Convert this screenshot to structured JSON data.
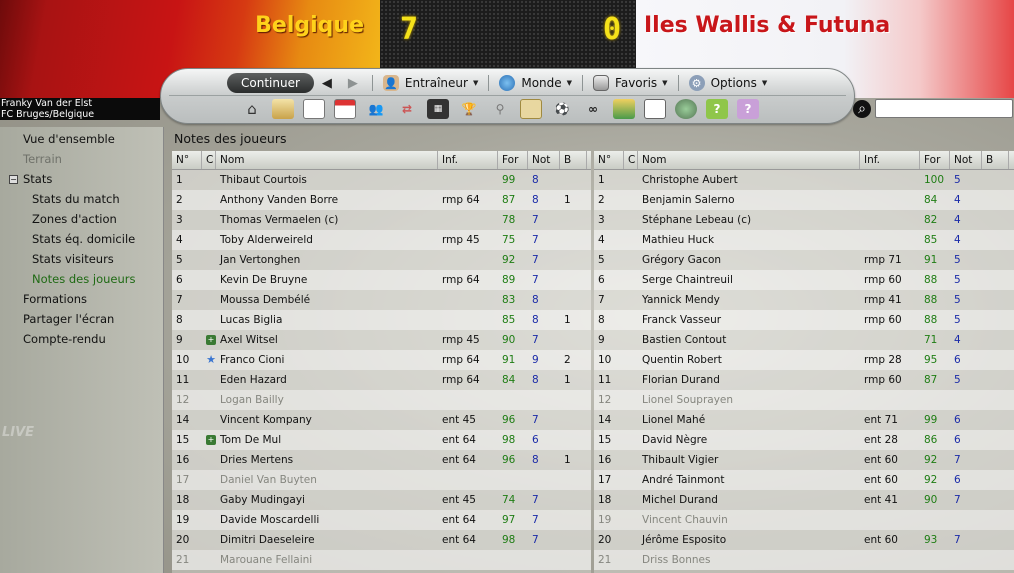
{
  "header": {
    "home_team": "Belgique",
    "home_score": "7",
    "away_score": "0",
    "away_team": "Iles Wallis & Futuna"
  },
  "toolbar": {
    "continue_label": "Continuer",
    "back_icon": "arrow-left",
    "forward_icon": "arrow-right",
    "menus": [
      {
        "label": "Entraîneur",
        "icon": "manager-icon"
      },
      {
        "label": "Monde",
        "icon": "globe-icon"
      },
      {
        "label": "Favoris",
        "icon": "bookmark-icon"
      },
      {
        "label": "Options",
        "icon": "options-icon"
      }
    ],
    "quick_icons": [
      "home-icon",
      "inbox-icon",
      "document-icon",
      "calendar-icon",
      "team-icon",
      "transfer-icon",
      "tactics-icon",
      "trophy-icon",
      "search-people-icon",
      "notes-icon",
      "match-icon",
      "binoculars-icon",
      "news-icon",
      "world-icon",
      "help-icon",
      "info-icon"
    ]
  },
  "manager": {
    "name": "Franky Van der Elst",
    "club": "FC Bruges/Belgique"
  },
  "search": {
    "placeholder": ""
  },
  "sidebar": {
    "items": [
      {
        "label": "Vue d'ensemble"
      },
      {
        "label": "Terrain"
      },
      {
        "label": "Stats"
      },
      {
        "label": "Stats du match"
      },
      {
        "label": "Zones d'action"
      },
      {
        "label": "Stats éq. domicile"
      },
      {
        "label": "Stats visiteurs"
      },
      {
        "label": "Notes des joueurs"
      },
      {
        "label": "Formations"
      },
      {
        "label": "Partager l'écran"
      },
      {
        "label": "Compte-rendu"
      }
    ],
    "stats_toggle": "−"
  },
  "main": {
    "title": "Notes des joueurs",
    "columns": [
      "N°",
      "C",
      "Nom",
      "Inf.",
      "For",
      "Not",
      "B"
    ],
    "home_players": [
      {
        "n": "1",
        "c": "",
        "name": "Thibaut Courtois",
        "inf": "",
        "for": "99",
        "not": "8",
        "b": ""
      },
      {
        "n": "2",
        "c": "",
        "name": "Anthony Vanden Borre",
        "inf": "rmp 64",
        "for": "87",
        "not": "8",
        "b": "1"
      },
      {
        "n": "3",
        "c": "",
        "name": "Thomas Vermaelen (c)",
        "inf": "",
        "for": "78",
        "not": "7",
        "b": ""
      },
      {
        "n": "4",
        "c": "",
        "name": "Toby Alderweireld",
        "inf": "rmp 45",
        "for": "75",
        "not": "7",
        "b": ""
      },
      {
        "n": "5",
        "c": "",
        "name": "Jan Vertonghen",
        "inf": "",
        "for": "92",
        "not": "7",
        "b": ""
      },
      {
        "n": "6",
        "c": "",
        "name": "Kevin De Bruyne",
        "inf": "rmp 64",
        "for": "89",
        "not": "7",
        "b": ""
      },
      {
        "n": "7",
        "c": "",
        "name": "Moussa Dembélé",
        "inf": "",
        "for": "83",
        "not": "8",
        "b": ""
      },
      {
        "n": "8",
        "c": "",
        "name": "Lucas Biglia",
        "inf": "",
        "for": "85",
        "not": "8",
        "b": "1"
      },
      {
        "n": "9",
        "c": "+",
        "name": "Axel Witsel",
        "inf": "rmp 45",
        "for": "90",
        "not": "7",
        "b": ""
      },
      {
        "n": "10",
        "c": "★",
        "name": "Franco Cioni",
        "inf": "rmp 64",
        "for": "91",
        "not": "9",
        "b": "2"
      },
      {
        "n": "11",
        "c": "",
        "name": "Eden Hazard",
        "inf": "rmp 64",
        "for": "84",
        "not": "8",
        "b": "1"
      },
      {
        "n": "12",
        "c": "",
        "name": "Logan Bailly",
        "inf": "",
        "for": "",
        "not": "",
        "b": ""
      },
      {
        "n": "14",
        "c": "",
        "name": "Vincent Kompany",
        "inf": "ent 45",
        "for": "96",
        "not": "7",
        "b": ""
      },
      {
        "n": "15",
        "c": "+",
        "name": "Tom De Mul",
        "inf": "ent 64",
        "for": "98",
        "not": "6",
        "b": ""
      },
      {
        "n": "16",
        "c": "",
        "name": "Dries Mertens",
        "inf": "ent 64",
        "for": "96",
        "not": "8",
        "b": "1"
      },
      {
        "n": "17",
        "c": "",
        "name": "Daniel Van Buyten",
        "inf": "",
        "for": "",
        "not": "",
        "b": ""
      },
      {
        "n": "18",
        "c": "",
        "name": "Gaby Mudingayi",
        "inf": "ent 45",
        "for": "74",
        "not": "7",
        "b": ""
      },
      {
        "n": "19",
        "c": "",
        "name": "Davide Moscardelli",
        "inf": "ent 64",
        "for": "97",
        "not": "7",
        "b": ""
      },
      {
        "n": "20",
        "c": "",
        "name": "Dimitri Daeseleire",
        "inf": "ent 64",
        "for": "98",
        "not": "7",
        "b": ""
      },
      {
        "n": "21",
        "c": "",
        "name": "Marouane Fellaini",
        "inf": "",
        "for": "",
        "not": "",
        "b": ""
      }
    ],
    "away_players": [
      {
        "n": "1",
        "c": "",
        "name": "Christophe Aubert",
        "inf": "",
        "for": "100",
        "not": "5",
        "b": ""
      },
      {
        "n": "2",
        "c": "",
        "name": "Benjamin Salerno",
        "inf": "",
        "for": "84",
        "not": "4",
        "b": ""
      },
      {
        "n": "3",
        "c": "",
        "name": "Stéphane Lebeau (c)",
        "inf": "",
        "for": "82",
        "not": "4",
        "b": ""
      },
      {
        "n": "4",
        "c": "",
        "name": "Mathieu Huck",
        "inf": "",
        "for": "85",
        "not": "4",
        "b": ""
      },
      {
        "n": "5",
        "c": "",
        "name": "Grégory Gacon",
        "inf": "rmp 71",
        "for": "91",
        "not": "5",
        "b": ""
      },
      {
        "n": "6",
        "c": "",
        "name": "Serge Chaintreuil",
        "inf": "rmp 60",
        "for": "88",
        "not": "5",
        "b": ""
      },
      {
        "n": "7",
        "c": "",
        "name": "Yannick Mendy",
        "inf": "rmp 41",
        "for": "88",
        "not": "5",
        "b": ""
      },
      {
        "n": "8",
        "c": "",
        "name": "Franck Vasseur",
        "inf": "rmp 60",
        "for": "88",
        "not": "5",
        "b": ""
      },
      {
        "n": "9",
        "c": "",
        "name": "Bastien Contout",
        "inf": "",
        "for": "71",
        "not": "4",
        "b": ""
      },
      {
        "n": "10",
        "c": "",
        "name": "Quentin Robert",
        "inf": "rmp 28",
        "for": "95",
        "not": "6",
        "b": ""
      },
      {
        "n": "11",
        "c": "",
        "name": "Florian Durand",
        "inf": "rmp 60",
        "for": "87",
        "not": "5",
        "b": ""
      },
      {
        "n": "12",
        "c": "",
        "name": "Lionel Souprayen",
        "inf": "",
        "for": "",
        "not": "",
        "b": ""
      },
      {
        "n": "14",
        "c": "",
        "name": "Lionel Mahé",
        "inf": "ent 71",
        "for": "99",
        "not": "6",
        "b": ""
      },
      {
        "n": "15",
        "c": "",
        "name": "David Nègre",
        "inf": "ent 28",
        "for": "86",
        "not": "6",
        "b": ""
      },
      {
        "n": "16",
        "c": "",
        "name": "Thibault Vigier",
        "inf": "ent 60",
        "for": "92",
        "not": "7",
        "b": ""
      },
      {
        "n": "17",
        "c": "",
        "name": "André Tainmont",
        "inf": "ent 60",
        "for": "92",
        "not": "6",
        "b": ""
      },
      {
        "n": "18",
        "c": "",
        "name": "Michel Durand",
        "inf": "ent 41",
        "for": "90",
        "not": "7",
        "b": ""
      },
      {
        "n": "19",
        "c": "",
        "name": "Vincent Chauvin",
        "inf": "",
        "for": "",
        "not": "",
        "b": ""
      },
      {
        "n": "20",
        "c": "",
        "name": "Jérôme Esposito",
        "inf": "ent 60",
        "for": "93",
        "not": "7",
        "b": ""
      },
      {
        "n": "21",
        "c": "",
        "name": "Driss Bonnes",
        "inf": "",
        "for": "",
        "not": "",
        "b": ""
      }
    ]
  },
  "watermark": "LIVE",
  "colors": {
    "home_name": "#ffd21b",
    "away_name": "#c8161a",
    "score": "#f5e21a",
    "for_value": "#1f7d14",
    "not_value": "#1a2aa8",
    "active_sidebar": "#1f6a14"
  }
}
